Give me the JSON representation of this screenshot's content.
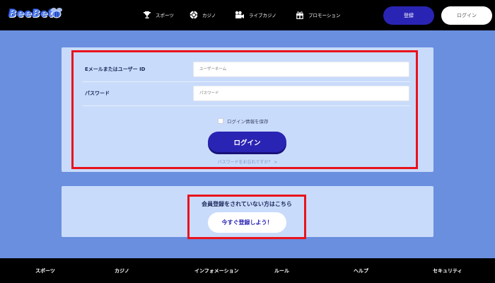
{
  "header": {
    "logo_text": "BeeBet",
    "nav": [
      {
        "label": "スポーツ",
        "icon": "trophy-icon"
      },
      {
        "label": "カジノ",
        "icon": "poker-chip-icon"
      },
      {
        "label": "ライブカジノ",
        "icon": "video-camera-icon"
      },
      {
        "label": "プロモーション",
        "icon": "gift-icon"
      }
    ],
    "register_label": "登録",
    "login_label": "ログイン"
  },
  "login_form": {
    "user_label": "Eメールまたはユーザー ID",
    "user_placeholder": "ユーザーネーム",
    "password_label": "パスワード",
    "password_placeholder": "パスワード",
    "remember_label": "ログイン情報を保存",
    "login_button": "ログイン",
    "forgot_link": "パスワードをお忘れですか？ >"
  },
  "registration": {
    "prompt": "会員登録をされていない方はこちら",
    "button": "今すぐ登録しよう！"
  },
  "footer": {
    "items": [
      "スポーツ",
      "カジノ",
      "インフォメーション",
      "ルール",
      "ヘルプ",
      "セキュリティ"
    ]
  },
  "colors": {
    "background": "#6b8fdf",
    "card": "#c9dbfb",
    "primary": "#2a24b4",
    "highlight": "#e8131c",
    "header": "#000000"
  }
}
